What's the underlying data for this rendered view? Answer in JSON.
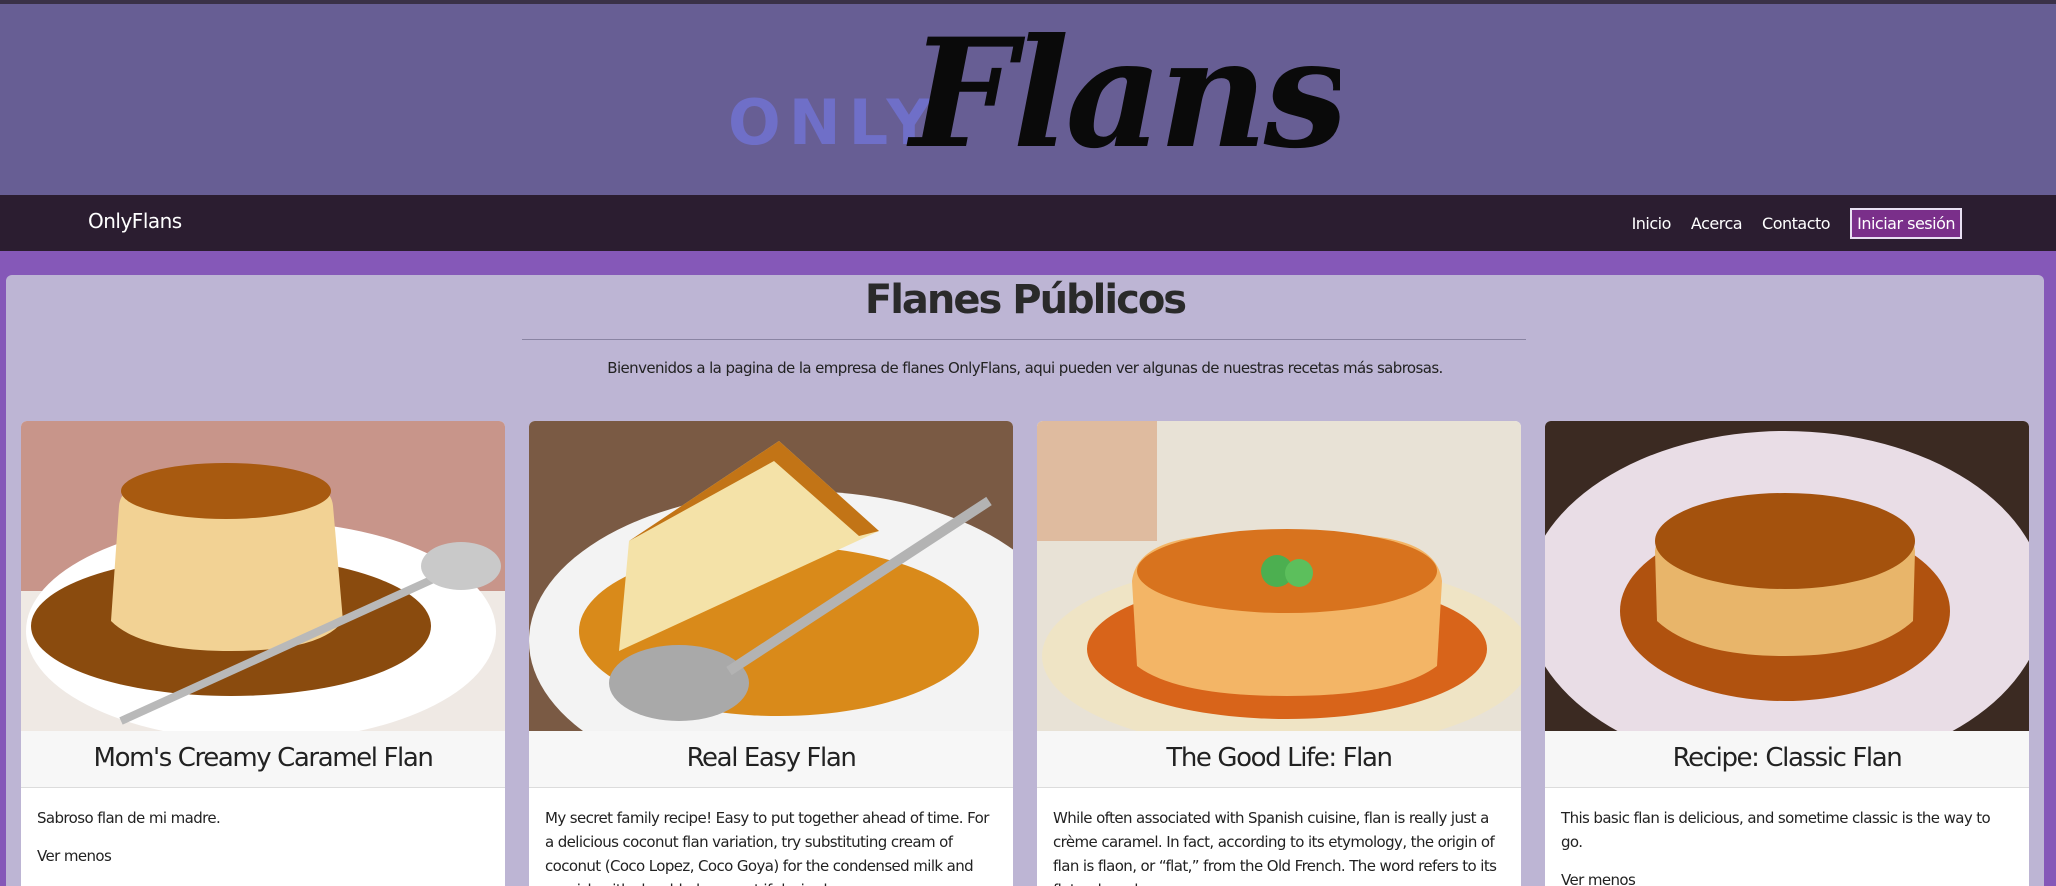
{
  "logo": {
    "prefix": "ONLY",
    "script": "Flans"
  },
  "navbar": {
    "brand": "OnlyFlans",
    "links": [
      "Inicio",
      "Acerca",
      "Contacto"
    ],
    "login": "Iniciar sesión"
  },
  "main": {
    "title": "Flanes Públicos",
    "intro": "Bienvenidos a la pagina de la empresa de flanes OnlyFlans, aqui pueden ver algunas de nuestras recetas más sabrosas."
  },
  "cards": [
    {
      "title": "Mom's Creamy Caramel Flan",
      "text": "Sabroso flan de mi madre.",
      "toggle": "Ver menos"
    },
    {
      "title": "Real Easy Flan",
      "text": "My secret family recipe! Easy to put together ahead of time. For a delicious coconut flan variation, try substituting cream of coconut (Coco Lopez, Coco Goya) for the condensed milk and garnish with shredded coconut if desired.",
      "toggle": ""
    },
    {
      "title": "The Good Life: Flan",
      "text": "While often associated with Spanish cuisine, flan is really just a crème caramel. In fact, according to its etymology, the origin of flan is flaon, or “flat,” from the Old French. The word refers to its flat or broad appearance,",
      "toggle": ""
    },
    {
      "title": "Recipe: Classic Flan",
      "text": "This basic flan is delicious, and sometime classic is the way to go.",
      "toggle": "Ver menos"
    }
  ],
  "colors": {
    "banner": "#675e94",
    "navbar": "#2b1d30",
    "page": "#8558b8",
    "container": "#bdb5d4",
    "login_bg": "#7a2f8a"
  }
}
